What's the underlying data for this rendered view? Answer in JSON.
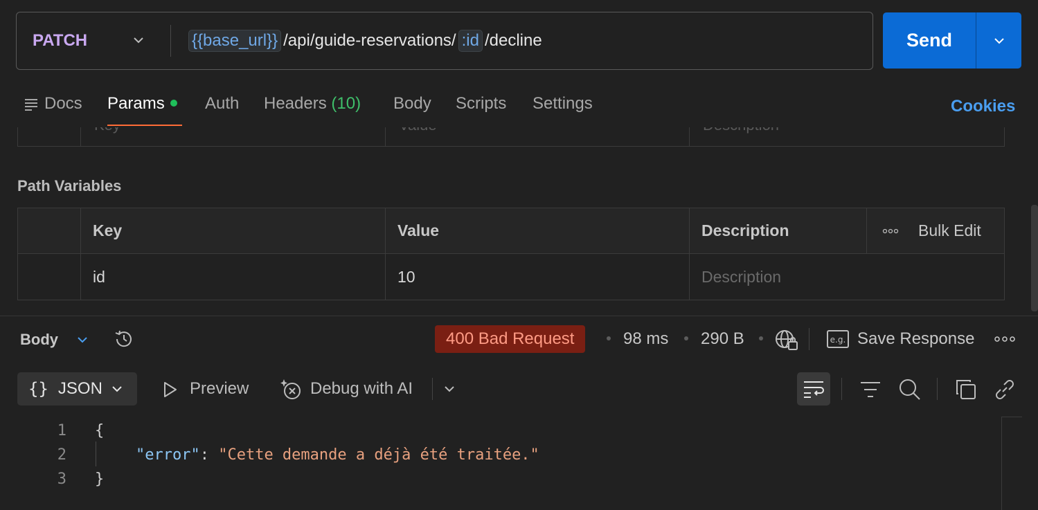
{
  "request": {
    "method": "PATCH",
    "url_segments": [
      "{{base_url}}",
      "/api/guide-reservations/",
      ":id",
      "/decline"
    ],
    "send_label": "Send"
  },
  "tabs": {
    "docs": "Docs",
    "params": "Params",
    "auth": "Auth",
    "headers": "Headers",
    "headers_count": "(10)",
    "body": "Body",
    "scripts": "Scripts",
    "settings": "Settings",
    "cookies": "Cookies",
    "active": "params"
  },
  "query_table": {
    "key_header": "Key",
    "value_header": "Value",
    "description_header": "Description"
  },
  "path_variables": {
    "title": "Path Variables",
    "headers": {
      "key": "Key",
      "value": "Value",
      "description": "Description",
      "bulk_edit": "Bulk Edit"
    },
    "rows": [
      {
        "key": "id",
        "value": "10",
        "description_placeholder": "Description"
      }
    ]
  },
  "response": {
    "section_label": "Body",
    "status": "400 Bad Request",
    "time": "98 ms",
    "size": "290 B",
    "save_label": "Save Response",
    "format": "JSON",
    "preview_label": "Preview",
    "debug_label": "Debug with AI",
    "code_lines": [
      {
        "n": "1",
        "text": "{"
      },
      {
        "n": "2",
        "key": "\"error\"",
        "sep": ": ",
        "value": "\"Cette demande a déjà été traitée.\""
      },
      {
        "n": "3",
        "text": "}"
      }
    ]
  },
  "colors": {
    "accent": "#0b6bd6",
    "method": "#c9a8f0",
    "status_bg": "#7a1f13",
    "status_text": "#ff9b85",
    "tab_underline": "#ff6c37",
    "headers_count": "#3fbf6a",
    "cookies": "#4a9ef0"
  },
  "icons": [
    "chevron-down-icon",
    "docs-icon",
    "history-icon",
    "globe-lock-icon",
    "example-icon",
    "more-icon",
    "play-icon",
    "ai-debug-icon",
    "wrap-icon",
    "filter-icon",
    "search-icon",
    "copy-icon",
    "link-icon"
  ]
}
